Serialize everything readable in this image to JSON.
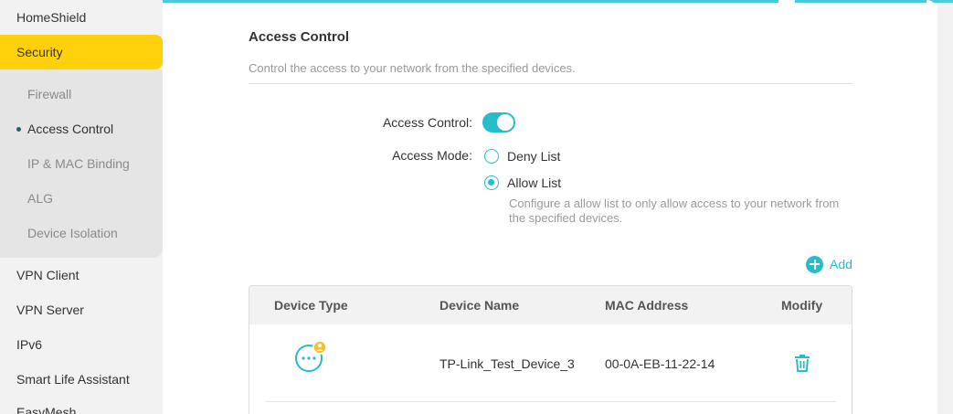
{
  "sidebar": {
    "items_top": [
      {
        "label": "HomeShield"
      },
      {
        "label": "Security"
      }
    ],
    "subitems": [
      {
        "label": "Firewall"
      },
      {
        "label": "Access Control"
      },
      {
        "label": "IP & MAC Binding"
      },
      {
        "label": "ALG"
      },
      {
        "label": "Device Isolation"
      }
    ],
    "items_bottom": [
      {
        "label": "VPN Client"
      },
      {
        "label": "VPN Server"
      },
      {
        "label": "IPv6"
      },
      {
        "label": "Smart Life Assistant"
      },
      {
        "label": "EasyMesh"
      }
    ]
  },
  "page": {
    "title": "Access Control",
    "description": "Control the access to your network from the specified devices."
  },
  "form": {
    "access_control_label": "Access Control:",
    "access_control_enabled": true,
    "access_mode_label": "Access Mode:",
    "deny_label": "Deny List",
    "allow_label": "Allow List",
    "selected_mode": "Allow List",
    "hint": "Configure a allow list to only allow access to your network from the specified devices."
  },
  "add_label": "Add",
  "table": {
    "headers": [
      "Device Type",
      "Device Name",
      "MAC Address",
      "Modify"
    ],
    "rows": [
      {
        "device_type_icon": "device-icon",
        "device_name": "TP-Link_Test_Device_3",
        "mac": "00-0A-EB-11-22-14",
        "modify_icon": "trash-icon"
      }
    ]
  },
  "colors": {
    "accent": "#26bcc9",
    "active_nav": "#ffd10a",
    "badge": "#f2c230"
  }
}
